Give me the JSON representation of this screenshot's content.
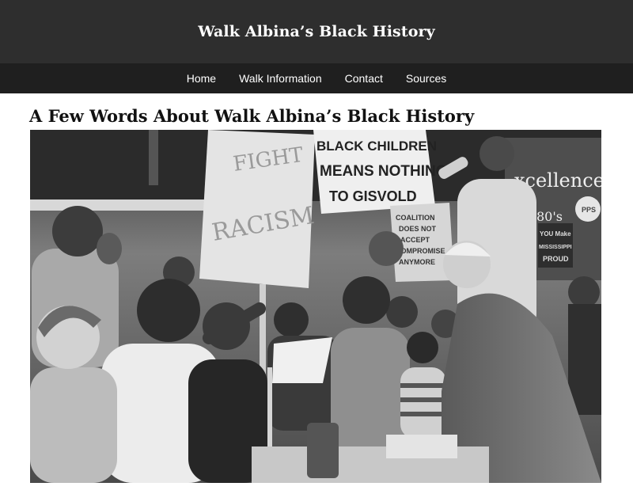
{
  "site": {
    "title": "Walk Albina’s Black History"
  },
  "nav": {
    "items": [
      {
        "label": "Home"
      },
      {
        "label": "Walk Information"
      },
      {
        "label": "Contact"
      },
      {
        "label": "Sources"
      }
    ]
  },
  "page": {
    "heading": "A Few Words About Walk Albina’s Black History"
  },
  "photo": {
    "signs": {
      "main_line1": "BLACK CHILDREN",
      "main_line2": "MEANS NOTHING",
      "main_line3": "TO  GISVOLD",
      "fight_line1": "FIGHT",
      "fight_line2": "RACISM",
      "coalition_line1": "COALITION",
      "coalition_line2": "DOES NOT",
      "coalition_line3": "ACCEPT",
      "coalition_line4": "COMPROMISE",
      "coalition_line5": "ANYMORE",
      "mississippi_line1": "YOU Make",
      "mississippi_line2": "MISSISSIPPI",
      "mississippi_line3": "PROUD",
      "banner_word": "xcellence",
      "banner_year": "80's",
      "banner_badge": "PPS"
    }
  }
}
